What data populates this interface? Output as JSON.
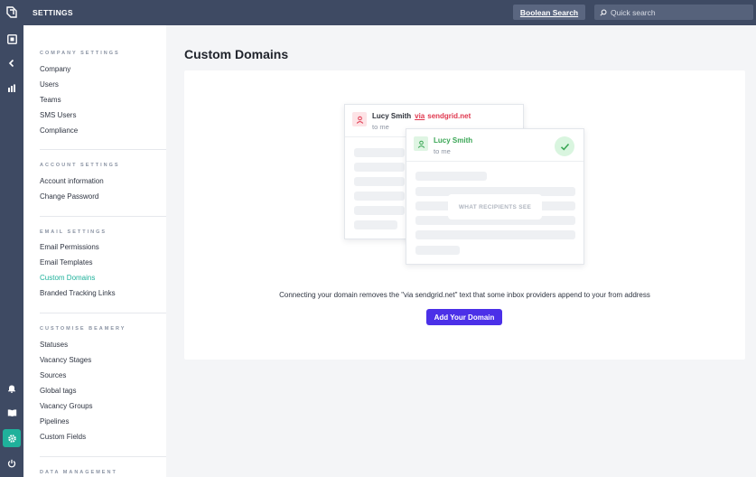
{
  "topbar": {
    "title": "SETTINGS",
    "boolean_search_label": "Boolean Search",
    "quick_search_placeholder": "Quick search"
  },
  "rail": {
    "top_icons": [
      "logo-icon",
      "dashboard-icon",
      "collapse-chevron-icon",
      "reports-icon"
    ],
    "bottom_icons": [
      "bell-icon",
      "book-icon",
      "gear-icon",
      "power-icon"
    ],
    "active": "gear-icon",
    "active_color": "#1fb19b"
  },
  "sidebar": {
    "sections": [
      {
        "heading": "COMPANY SETTINGS",
        "items": [
          "Company",
          "Users",
          "Teams",
          "SMS Users",
          "Compliance"
        ]
      },
      {
        "heading": "ACCOUNT SETTINGS",
        "items": [
          "Account information",
          "Change Password"
        ]
      },
      {
        "heading": "EMAIL SETTINGS",
        "items": [
          "Email Permissions",
          "Email Templates",
          "Custom Domains",
          "Branded Tracking Links"
        ]
      },
      {
        "heading": "CUSTOMISE BEAMERY",
        "items": [
          "Statuses",
          "Vacancy Stages",
          "Sources",
          "Global tags",
          "Vacancy Groups",
          "Pipelines",
          "Custom Fields"
        ]
      },
      {
        "heading": "DATA MANAGEMENT",
        "items": []
      }
    ],
    "active_item": "Custom Domains"
  },
  "main": {
    "title": "Custom Domains",
    "illustration": {
      "back_sender": "Lucy Smith",
      "back_via": "via",
      "back_domain": "sendgrid.net",
      "back_to": "to me",
      "front_sender": "Lucy Smith",
      "front_to": "to me",
      "recipients_label": "WHAT RECIPIENTS SEE"
    },
    "description": "Connecting your domain removes the \"via sendgrid.net\" text that some inbox providers append to your from address",
    "add_button": "Add Your Domain",
    "colors": {
      "brand_button": "#4b30e8",
      "warning": "#e0384f",
      "success": "#3aa655"
    }
  }
}
